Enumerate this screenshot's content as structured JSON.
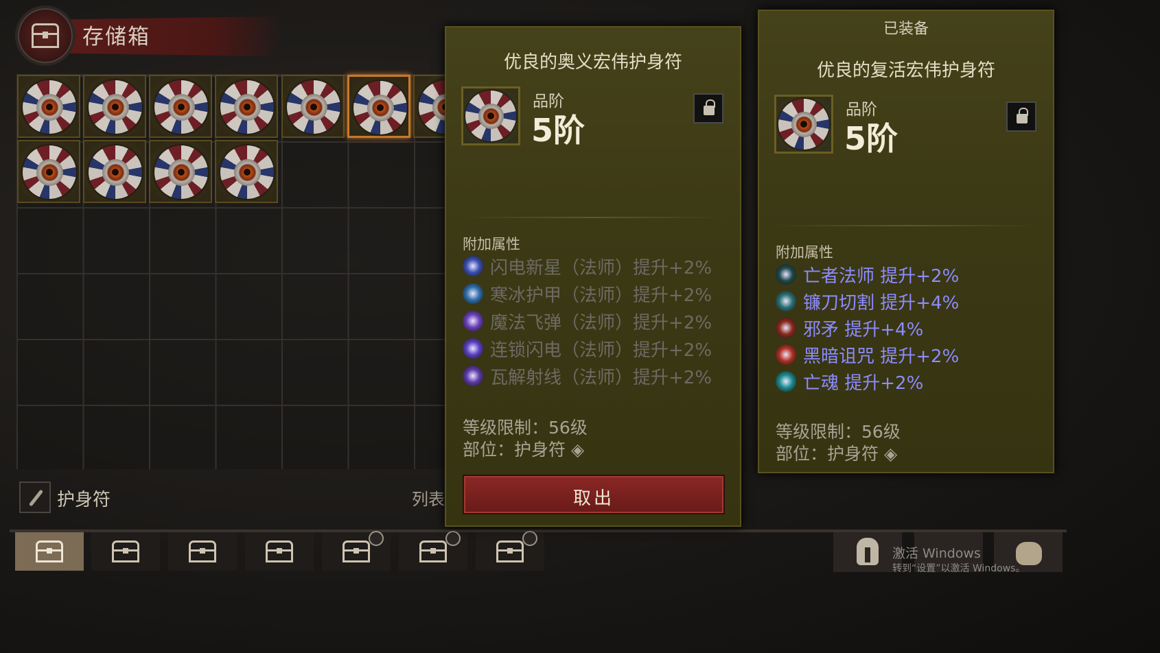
{
  "header": {
    "title": "存储箱"
  },
  "category": {
    "label": "护身符",
    "list_label": "列表"
  },
  "item_panel": {
    "title": "优良的奥义宏伟护身符",
    "tier_label": "品阶",
    "tier_value": "5阶",
    "attributes_heading": "附加属性",
    "affixes": [
      {
        "text": "闪电新星（法师）提升+2%",
        "icon": "lightning-nova-icon",
        "color": "#6d6a64"
      },
      {
        "text": "寒冰护甲（法师）提升+2%",
        "icon": "frost-armor-icon",
        "color": "#6d6a64"
      },
      {
        "text": "魔法飞弹（法师）提升+2%",
        "icon": "magic-missile-icon",
        "color": "#6d6a64"
      },
      {
        "text": "连锁闪电（法师）提升+2%",
        "icon": "chain-lightning-icon",
        "color": "#6d6a64"
      },
      {
        "text": "瓦解射线（法师）提升+2%",
        "icon": "disintegrate-icon",
        "color": "#6d6a64"
      }
    ],
    "level_requirement": "等级限制：56级",
    "slot": "部位：护身符",
    "take_out_label": "取出"
  },
  "equipped_panel": {
    "header": "已装备",
    "title": "优良的复活宏伟护身符",
    "tier_label": "品阶",
    "tier_value": "5阶",
    "attributes_heading": "附加属性",
    "affixes": [
      {
        "text": "亡者法师  提升+2%",
        "icon": "skeletal-mage-icon",
        "color": "#8c8cff"
      },
      {
        "text": "镰刀切割  提升+4%",
        "icon": "scythe-icon",
        "color": "#8c8cff"
      },
      {
        "text": "邪矛  提升+4%",
        "icon": "bone-spear-icon",
        "color": "#8c8cff"
      },
      {
        "text": "黑暗诅咒  提升+2%",
        "icon": "dark-curse-icon",
        "color": "#8c8cff"
      },
      {
        "text": "亡魂  提升+2%",
        "icon": "spirit-icon",
        "color": "#8c8cff"
      }
    ],
    "level_requirement": "等级限制：56级",
    "slot": "部位：护身符"
  },
  "watermark": {
    "line1": "激活 Windows",
    "line2": "转到“设置”以激活 Windows。"
  },
  "colors": {
    "accent": "#c7792b",
    "button": "#7a2220",
    "panel": "#3f3c17",
    "buff_text": "#8c8cff",
    "inactive_affix": "#6d6a64"
  }
}
